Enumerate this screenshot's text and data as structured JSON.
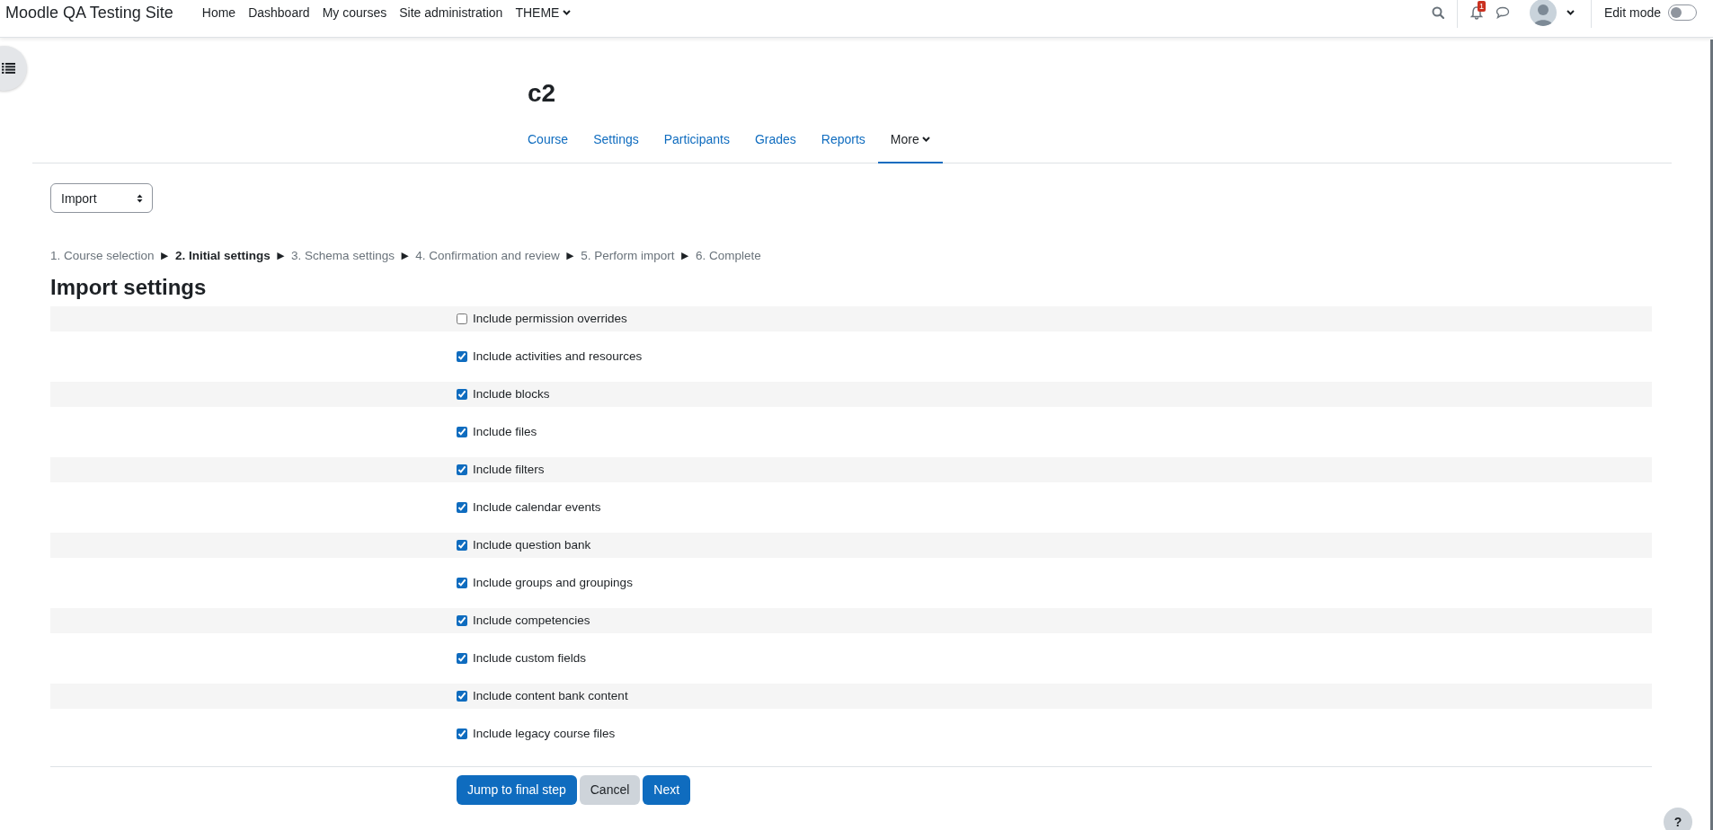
{
  "navbar": {
    "site_name": "Moodle QA Testing Site",
    "links": [
      {
        "label": "Home",
        "dropdown": false
      },
      {
        "label": "Dashboard",
        "dropdown": false
      },
      {
        "label": "My courses",
        "dropdown": false
      },
      {
        "label": "Site administration",
        "dropdown": false
      },
      {
        "label": "THEME",
        "dropdown": true
      }
    ],
    "notification_count": "1",
    "edit_mode": {
      "label": "Edit mode",
      "on": false
    }
  },
  "course": {
    "title": "c2",
    "tabs": [
      {
        "label": "Course",
        "selected": false,
        "dropdown": false
      },
      {
        "label": "Settings",
        "selected": false,
        "dropdown": false
      },
      {
        "label": "Participants",
        "selected": false,
        "dropdown": false
      },
      {
        "label": "Grades",
        "selected": false,
        "dropdown": false
      },
      {
        "label": "Reports",
        "selected": false,
        "dropdown": false
      },
      {
        "label": "More",
        "selected": true,
        "dropdown": true
      }
    ]
  },
  "action_select": {
    "value": "Import"
  },
  "steps": [
    {
      "label": "1. Course selection",
      "selected": false
    },
    {
      "separator": "►",
      "label": "2. Initial settings",
      "selected": true
    },
    {
      "separator": "►",
      "label": "3. Schema settings",
      "selected": false
    },
    {
      "separator": "►",
      "label": "4. Confirmation and review",
      "selected": false
    },
    {
      "separator": "►",
      "label": "5. Perform import",
      "selected": false
    },
    {
      "separator": "►",
      "label": "6. Complete",
      "selected": false
    }
  ],
  "heading": "Import settings",
  "options": [
    {
      "label": "Include permission overrides",
      "checked": false
    },
    {
      "label": "Include activities and resources",
      "checked": true
    },
    {
      "label": "Include blocks",
      "checked": true
    },
    {
      "label": "Include files",
      "checked": true
    },
    {
      "label": "Include filters",
      "checked": true
    },
    {
      "label": "Include calendar events",
      "checked": true
    },
    {
      "label": "Include question bank",
      "checked": true
    },
    {
      "label": "Include groups and groupings",
      "checked": true
    },
    {
      "label": "Include competencies",
      "checked": true
    },
    {
      "label": "Include custom fields",
      "checked": true
    },
    {
      "label": "Include content bank content",
      "checked": true
    },
    {
      "label": "Include legacy course files",
      "checked": true
    }
  ],
  "buttons": [
    {
      "label": "Jump to final step",
      "kind": "primary"
    },
    {
      "label": "Cancel",
      "kind": "secondary"
    },
    {
      "label": "Next",
      "kind": "primary"
    }
  ],
  "help_button": "?"
}
